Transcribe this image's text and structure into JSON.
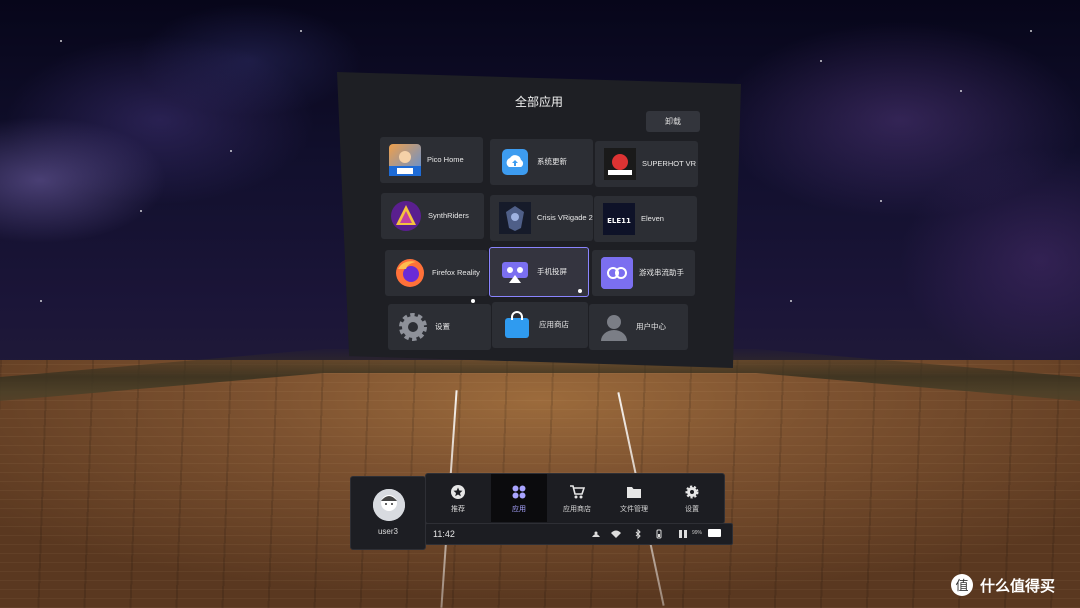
{
  "panel": {
    "title": "全部应用",
    "uninstall_label": "卸载",
    "apps": [
      {
        "label": "Pico Home",
        "icon": "pico-home-icon"
      },
      {
        "label": "系统更新",
        "icon": "cloud-upload-icon"
      },
      {
        "label": "SUPERHOT VR",
        "icon": "superhot-icon"
      },
      {
        "label": "SynthRiders",
        "icon": "synthriders-icon"
      },
      {
        "label": "Crisis VRigade 2",
        "icon": "crisis-vrigade-icon"
      },
      {
        "label": "Eleven",
        "icon": "eleven-icon"
      },
      {
        "label": "Firefox Reality",
        "icon": "firefox-icon"
      },
      {
        "label": "手机投屏",
        "icon": "screen-cast-icon"
      },
      {
        "label": "游戏串流助手",
        "icon": "streaming-assistant-icon"
      },
      {
        "label": "设置",
        "icon": "settings-gear-icon"
      },
      {
        "label": "应用商店",
        "icon": "shopping-bag-icon"
      },
      {
        "label": "用户中心",
        "icon": "user-icon"
      }
    ]
  },
  "user": {
    "name": "user3"
  },
  "dock": [
    {
      "label": "推荐",
      "icon": "star-icon",
      "active": false
    },
    {
      "label": "应用",
      "icon": "apps-grid-icon",
      "active": true
    },
    {
      "label": "应用商店",
      "icon": "cart-icon",
      "active": false
    },
    {
      "label": "文件管理",
      "icon": "folder-icon",
      "active": false
    },
    {
      "label": "设置",
      "icon": "gear-icon",
      "active": false
    }
  ],
  "status": {
    "time": "11:42",
    "battery_percent": "99%",
    "icons": [
      "controller-icon",
      "wifi-icon",
      "bluetooth-icon",
      "controller-battery-icon",
      "headset-battery-icon",
      "battery-icon"
    ]
  },
  "watermark": {
    "text": "什么值得买",
    "badge": "值"
  },
  "colors": {
    "accent": "#8a84ff",
    "panel_bg": "#1e1f24",
    "tile_bg": "#2c2e34"
  }
}
